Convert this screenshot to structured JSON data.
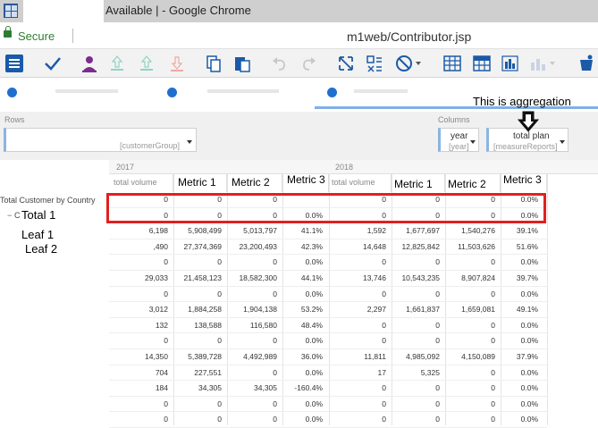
{
  "window": {
    "title": "Available | - Google Chrome",
    "secure_label": "Secure",
    "url": "m1web/Contributor.jsp"
  },
  "toolbar": {
    "icons": [
      "menu-icon",
      "check-icon",
      "user-submit-icon",
      "promote-icon",
      "promote-all-icon",
      "reject-icon",
      "copy-icon",
      "paste-icon",
      "undo-icon",
      "redo-icon",
      "expand-icon",
      "swap-icon",
      "block-icon",
      "grid-icon",
      "pivot-icon",
      "bar-chart-icon",
      "chart-options-icon",
      "bucket-icon"
    ]
  },
  "annotation": {
    "text": "This is aggregation"
  },
  "filters": {
    "rows_label": "Rows",
    "columns_label": "Columns",
    "rows_field": "[customerGroup]",
    "col1_value": "year",
    "col1_field": "[year]",
    "col2_value": "total plan",
    "col2_field": "[measureReports]"
  },
  "grid": {
    "years": [
      "2017",
      "2018"
    ],
    "col_headers_2017": [
      "total volume",
      "Metric 1",
      "Metric 2",
      "Metric 3"
    ],
    "col_headers_2018": [
      "total volume",
      "Metric 1",
      "Metric 2",
      "Metric 3"
    ],
    "row_labels": {
      "root": "Total Customer by Country",
      "total1_prefix": "C",
      "total1": "Total 1",
      "leaf1": "Leaf 1",
      "leaf2": "Leaf 2"
    },
    "rows": [
      [
        "0",
        "0",
        "0",
        "",
        "0",
        "0",
        "0",
        "0.0%"
      ],
      [
        "0",
        "0",
        "0",
        "0.0%",
        "0",
        "0",
        "0",
        "0.0%"
      ],
      [
        "6,198",
        "5,908,499",
        "5,013,797",
        "41.1%",
        "1,592",
        "1,677,697",
        "1,540,276",
        "39.1%"
      ],
      [
        ",490",
        "27,374,369",
        "23,200,493",
        "42.3%",
        "14,648",
        "12,825,842",
        "11,503,626",
        "51.6%"
      ],
      [
        "0",
        "0",
        "0",
        "0.0%",
        "0",
        "0",
        "0",
        "0.0%"
      ],
      [
        "29,033",
        "21,458,123",
        "18,582,300",
        "44.1%",
        "13,746",
        "10,543,235",
        "8,907,824",
        "39.7%"
      ],
      [
        "0",
        "0",
        "0",
        "0.0%",
        "0",
        "0",
        "0",
        "0.0%"
      ],
      [
        "3,012",
        "1,884,258",
        "1,904,138",
        "53.2%",
        "2,297",
        "1,661,837",
        "1,659,081",
        "49.1%"
      ],
      [
        "132",
        "138,588",
        "116,580",
        "48.4%",
        "0",
        "0",
        "0",
        "0.0%"
      ],
      [
        "0",
        "0",
        "0",
        "0.0%",
        "0",
        "0",
        "0",
        "0.0%"
      ],
      [
        "14,350",
        "5,389,728",
        "4,492,989",
        "36.0%",
        "11,811",
        "4,985,092",
        "4,150,089",
        "37.9%"
      ],
      [
        "704",
        "227,551",
        "0",
        "0.0%",
        "17",
        "5,325",
        "0",
        "0.0%"
      ],
      [
        "184",
        "34,305",
        "34,305",
        "-160.4%",
        "0",
        "0",
        "0",
        "0.0%"
      ],
      [
        "0",
        "0",
        "0",
        "0.0%",
        "0",
        "0",
        "0",
        "0.0%"
      ],
      [
        "0",
        "0",
        "0",
        "0.0%",
        "0",
        "0",
        "0",
        "0.0%"
      ]
    ]
  }
}
